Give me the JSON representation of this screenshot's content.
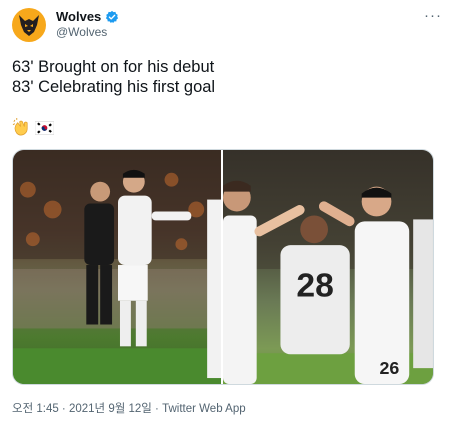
{
  "tweet": {
    "display_name": "Wolves",
    "handle": "@Wolves",
    "more_label": "···",
    "lines": [
      "63' Brought on for his debut",
      "83' Celebrating his first goal"
    ],
    "emojis": [
      "clapping-hands-icon",
      "south-korea-flag-icon"
    ],
    "jersey_numbers": [
      "28",
      "26"
    ],
    "timestamp": "오전 1:45 · 2021년 9월 12일",
    "separator": " · ",
    "source": "Twitter Web App"
  },
  "colors": {
    "brand": "#f7a81b",
    "verified": "#1d9bf0",
    "text": "#0f1419",
    "muted": "#536471"
  }
}
